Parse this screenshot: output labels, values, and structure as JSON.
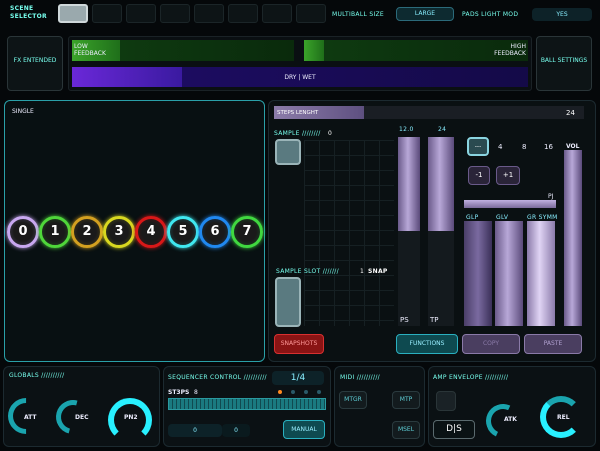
{
  "top": {
    "scene_selector": "SCENE SELECTOR",
    "multiball_size_label": "MULTIBALL SIZE",
    "multiball_size_value": "LARGE",
    "pads_light_mod_label": "PADS LIGHT MOD",
    "pads_light_mod_value": "YES"
  },
  "fx": {
    "fx_button": "FX ENTENDED",
    "low_feedback": "LOW FEEDBACK",
    "high_feedback": "HIGH FEEDBACK",
    "dry_wet": "DRY | WET",
    "ball_settings": "BALL SETTINGS"
  },
  "pad": {
    "label": "SINGLE",
    "balls": [
      "0",
      "1",
      "2",
      "3",
      "4",
      "5",
      "6",
      "7"
    ],
    "ball_colors": [
      "#c8a8f0",
      "#4fd63a",
      "#d3a020",
      "#d8d820",
      "#d81818",
      "#40e8f0",
      "#2088f0",
      "#40d840"
    ]
  },
  "seq": {
    "steps_label": "STEPS LENGHT",
    "steps_value": "24",
    "sample_label": "SAMPLE ////////",
    "sample_value": "0",
    "val_left": "12.0",
    "val_right": "24",
    "sample_slot_label": "SAMPLE SLOT ///////",
    "sample_slot_value": "1",
    "snap": "SNAP",
    "ps": "PS",
    "tp": "TP",
    "mode_buttons": [
      "---",
      "4",
      "8",
      "16"
    ],
    "vol": "VOL",
    "minus1": "-1",
    "plus1": "+1",
    "pj": "PJ",
    "glp": "GLP",
    "glv": "GLV",
    "gr_symm": "GR SYMM",
    "snapshots": "SNAPSHOTS",
    "functions": "FUNCTIONS",
    "copy": "COPY",
    "paste": "PASTE"
  },
  "bottom": {
    "globals": "GLOBALS //////////",
    "att": "ATT",
    "dec": "DEC",
    "pn2": "PN2",
    "seq_control": "SEQUENCER CONTROL //////////",
    "page": "1/4",
    "st3ps_label": "ST3PS",
    "st3ps_value": "8",
    "counter_a": "0",
    "counter_b": "0",
    "manual": "MANUAL",
    "midi": "MIDI //////////",
    "mtgr": "MTGR",
    "mtp": "MTP",
    "msel": "MSEL",
    "amp_env": "AMP ENVELOPE //////////",
    "atk": "ATK",
    "rel": "REL",
    "ds": "D|S"
  }
}
